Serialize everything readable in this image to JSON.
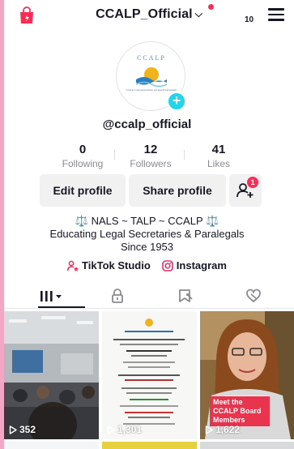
{
  "header": {
    "account_name": "CCALP_Official",
    "notification_count": "10"
  },
  "profile": {
    "avatar_org_short": "CCALP",
    "avatar_org_full": "Central Coast Association of Legal Professionals",
    "username": "@ccalp_official"
  },
  "stats": [
    {
      "value": "0",
      "label": "Following"
    },
    {
      "value": "12",
      "label": "Followers"
    },
    {
      "value": "41",
      "label": "Likes"
    }
  ],
  "buttons": {
    "edit_profile": "Edit profile",
    "share_profile": "Share profile",
    "add_friend_badge": "1"
  },
  "bio": {
    "line1": "⚖️ NALS ~ TALP ~ CCALP ⚖️",
    "line2": "Educating Legal Secretaries & Paralegals",
    "line3": "Since 1953"
  },
  "links": {
    "tiktok_studio": "TikTok Studio",
    "instagram": "Instagram"
  },
  "videos": [
    {
      "views": "352",
      "caption": ""
    },
    {
      "views": "1,301",
      "caption": ""
    },
    {
      "views": "1,622",
      "caption": "Meet the CCALP Board Members"
    }
  ],
  "colors": {
    "accent_red": "#fe2c55",
    "avatar_plus": "#20d5ec",
    "button_bg": "#f1f1f2",
    "caption_bg": "#e8344c"
  }
}
